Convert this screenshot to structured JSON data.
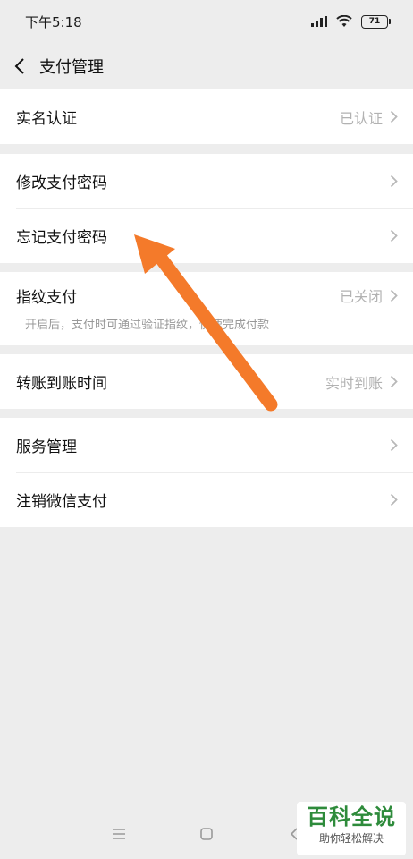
{
  "status_bar": {
    "time": "下午5:18",
    "battery": "71"
  },
  "nav": {
    "title": "支付管理"
  },
  "groups": [
    {
      "rows": [
        {
          "label": "实名认证",
          "value": "已认证"
        }
      ]
    },
    {
      "rows": [
        {
          "label": "修改支付密码",
          "value": ""
        },
        {
          "label": "忘记支付密码",
          "value": ""
        }
      ]
    },
    {
      "rows": [
        {
          "label": "指纹支付",
          "value": "已关闭",
          "sub": "开启后，支付时可通过验证指纹，快速完成付款"
        }
      ]
    },
    {
      "rows": [
        {
          "label": "转账到账时间",
          "value": "实时到账"
        }
      ]
    },
    {
      "rows": [
        {
          "label": "服务管理",
          "value": ""
        },
        {
          "label": "注销微信支付",
          "value": ""
        }
      ]
    }
  ],
  "annotation": {
    "arrow_color": "#f47a2a"
  },
  "watermark": {
    "title": "百科全说",
    "subtitle": "助你轻松解决"
  }
}
